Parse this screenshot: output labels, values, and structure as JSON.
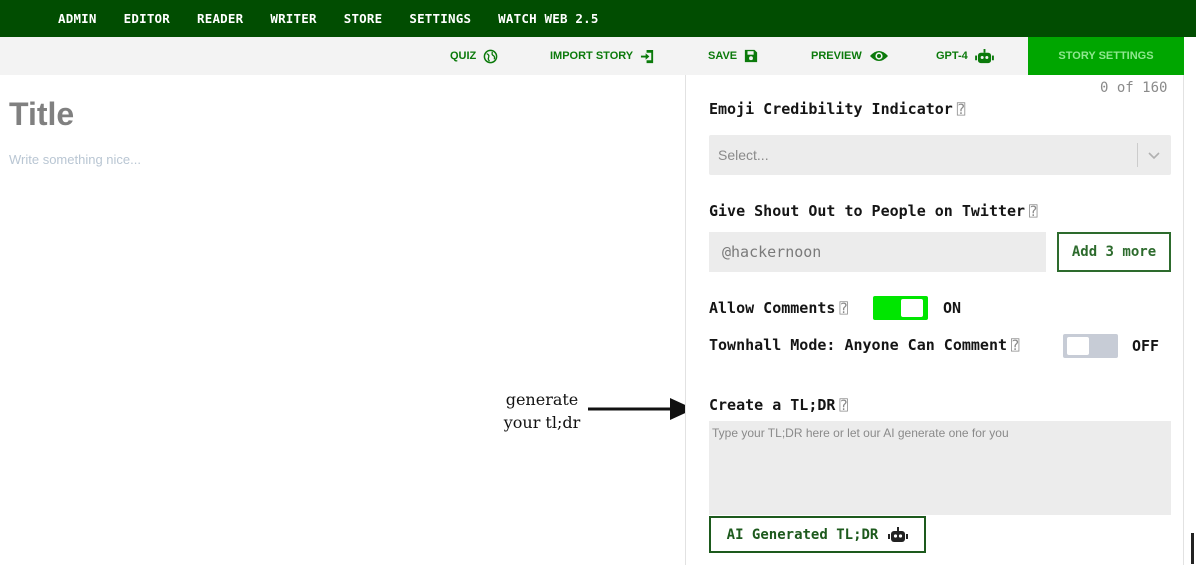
{
  "topnav": {
    "items": [
      "ADMIN",
      "EDITOR",
      "READER",
      "WRITER",
      "STORE",
      "SETTINGS",
      "WATCH WEB 2.5"
    ]
  },
  "toolbar": {
    "quiz": "QUIZ",
    "import_story": "IMPORT STORY",
    "save": "SAVE",
    "preview": "PREVIEW",
    "gpt4": "GPT-4",
    "story_settings": "STORY SETTINGS"
  },
  "editor": {
    "title_placeholder": "Title",
    "body_placeholder": "Write something nice..."
  },
  "annotation": {
    "line1": "generate",
    "line2": "your tl;dr"
  },
  "settings": {
    "counter": "0 of 160",
    "emoji_label": "Emoji Credibility Indicator",
    "emoji_select_placeholder": "Select...",
    "shoutout_label": "Give Shout Out to People on Twitter",
    "twitter_placeholder": "@hackernoon",
    "add_more_label": "Add 3 more",
    "allow_comments_label": "Allow Comments",
    "allow_comments_state": "ON",
    "townhall_label": "Townhall Mode: Anyone Can Comment",
    "townhall_state": "OFF",
    "tldr_label": "Create a TL;DR",
    "tldr_placeholder": "Type your TL;DR here or let our AI generate one for you",
    "ai_button_label": "AI Generated TL;DR"
  },
  "colors": {
    "nav_bg": "#014d01",
    "accent_green": "#0b7a0b",
    "active_tab_bg": "#00a600",
    "toggle_on": "#00e600",
    "toggle_off": "#c7ccd6"
  }
}
